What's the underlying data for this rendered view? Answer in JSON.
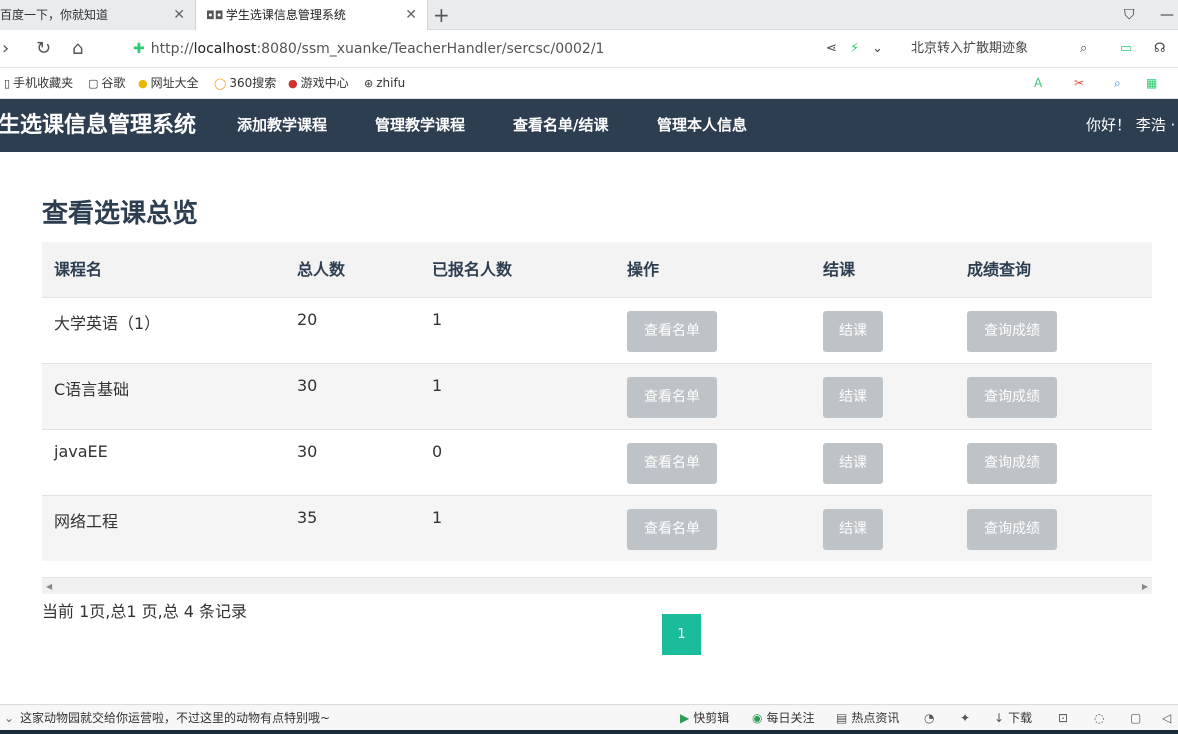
{
  "browser": {
    "tabs": [
      {
        "title": "百度一下，你就知道",
        "active": false
      },
      {
        "title": "学生选课信息管理系统",
        "active": true
      }
    ],
    "url_prefix": "http://",
    "url_host": "localhost",
    "url_rest": ":8080/ssm_xuanke/TeacherHandler/sercsc/0002/1",
    "search_hint": "北京转入扩散期迹象",
    "bookmarks": [
      "手机收藏夹",
      "谷歌",
      "网址大全",
      "360搜索",
      "游戏中心",
      "zhifu"
    ]
  },
  "app": {
    "brand": "生选课信息管理系统",
    "menu": [
      "添加教学课程",
      "管理教学课程",
      "查看名单/结课",
      "管理本人信息"
    ],
    "greeting": "你好！ 李浩 ·"
  },
  "main": {
    "title": "查看选课总览",
    "columns": [
      "课程名",
      "总人数",
      "已报名人数",
      "操作",
      "结课",
      "成绩查询"
    ],
    "rows": [
      {
        "name": "大学英语（1）",
        "total": "20",
        "enrolled": "1",
        "view": "查看名单",
        "close": "结课",
        "grades": "查询成绩"
      },
      {
        "name": "C语言基础",
        "total": "30",
        "enrolled": "1",
        "view": "查看名单",
        "close": "结课",
        "grades": "查询成绩"
      },
      {
        "name": "javaEE",
        "total": "30",
        "enrolled": "0",
        "view": "查看名单",
        "close": "结课",
        "grades": "查询成绩"
      },
      {
        "name": "网络工程",
        "total": "35",
        "enrolled": "1",
        "view": "查看名单",
        "close": "结课",
        "grades": "查询成绩"
      }
    ],
    "page_info": "当前 1页,总1 页,总 4 条记录",
    "current_page": "1"
  },
  "statusbar": {
    "news": "这家动物园就交给你运营啦，不过这里的动物有点特别哦~",
    "items": [
      "快剪辑",
      "每日关注",
      "热点资讯",
      "下载"
    ]
  },
  "colors": {
    "nav_bg": "#2c3e50",
    "button_disabled": "#bdc3c7",
    "pager_active": "#1abc9c"
  }
}
